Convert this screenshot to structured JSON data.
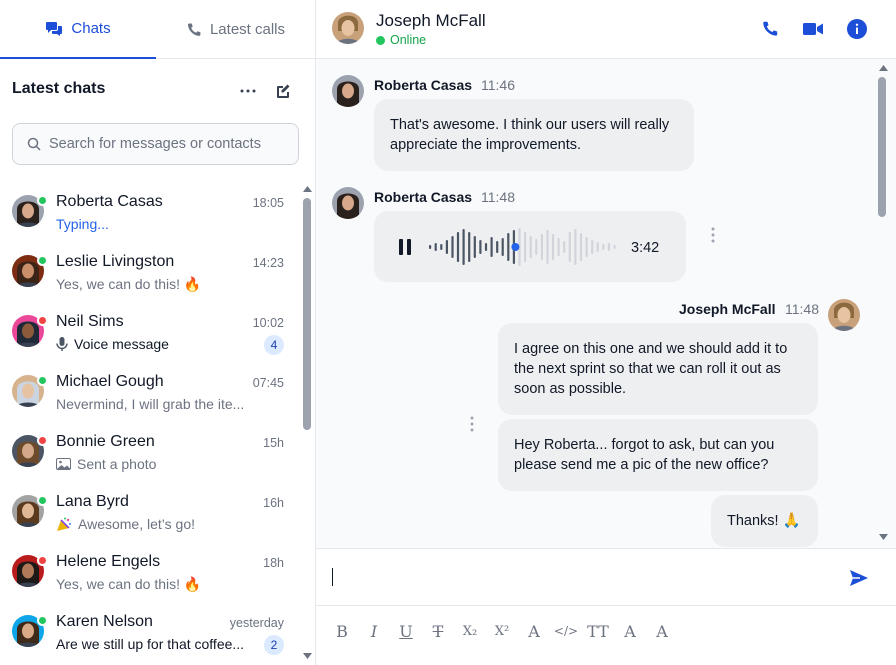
{
  "tabs": [
    {
      "label": "Chats",
      "icon": "chat-bubbles-icon",
      "active": true
    },
    {
      "label": "Latest calls",
      "icon": "phone-icon",
      "active": false
    }
  ],
  "sidebar": {
    "heading": "Latest chats",
    "search_placeholder": "Search for messages or contacts",
    "chats": [
      {
        "name": "Roberta Casas",
        "time": "18:05",
        "preview": "Typing...",
        "status": "online",
        "preview_style": "typing"
      },
      {
        "name": "Leslie Livingston",
        "time": "14:23",
        "preview": "Yes, we can do this! 🔥",
        "status": "online"
      },
      {
        "name": "Neil Sims",
        "time": "10:02",
        "preview": "Voice message",
        "status": "offline",
        "unread": "4",
        "preview_icon": "microphone-icon"
      },
      {
        "name": "Michael Gough",
        "time": "07:45",
        "preview": "Nevermind, I will grab the ite...",
        "status": "online"
      },
      {
        "name": "Bonnie Green",
        "time": "15h",
        "preview": "Sent a photo",
        "status": "offline",
        "preview_icon": "image-icon"
      },
      {
        "name": "Lana Byrd",
        "time": "16h",
        "preview": "Awesome, let’s go!",
        "status": "online",
        "preview_icon": "party-popper-icon"
      },
      {
        "name": "Helene Engels",
        "time": "18h",
        "preview": "Yes, we can do this! 🔥",
        "status": "offline"
      },
      {
        "name": "Karen Nelson",
        "time": "yesterday",
        "preview": "Are we still up for that coffee...",
        "status": "online",
        "unread": "2"
      }
    ]
  },
  "conversation": {
    "contact_name": "Joseph McFall",
    "contact_status": "Online",
    "messages": [
      {
        "sender": "Roberta Casas",
        "time": "11:46",
        "text": "That's awesome. I think our users will really appreciate the improvements."
      },
      {
        "sender": "Roberta Casas",
        "time": "11:48",
        "voice_duration": "3:42",
        "voice_progress": 0.46
      },
      {
        "sender": "Joseph McFall",
        "time": "11:48",
        "texts": [
          "I agree on this one and we should add it to the next sprint so that we can roll it out as soon as possible.",
          "Hey Roberta... forgot to ask, but can you please send me a pic of the new office?",
          "Thanks! 🙏"
        ]
      }
    ]
  },
  "composer": {
    "value": "",
    "formatting": [
      {
        "label": "B",
        "icon": "bold-icon"
      },
      {
        "label": "I",
        "icon": "italic-icon"
      },
      {
        "label": "U",
        "icon": "underline-icon"
      },
      {
        "label": "T",
        "icon": "strikethrough-icon"
      },
      {
        "label": "X₂",
        "icon": "subscript-icon"
      },
      {
        "label": "X²",
        "icon": "superscript-icon"
      },
      {
        "label": "A",
        "icon": "text-color-icon"
      },
      {
        "label": "</>",
        "icon": "code-icon"
      },
      {
        "label": "TT",
        "icon": "font-size-icon"
      },
      {
        "label": "A",
        "icon": "font-family-icon"
      },
      {
        "label": "A",
        "icon": "text-case-icon"
      }
    ]
  },
  "colors": {
    "accent": "#1d4ed8",
    "online": "#22c55e",
    "offline": "#ef4444",
    "bubble": "#f3f4f6"
  }
}
